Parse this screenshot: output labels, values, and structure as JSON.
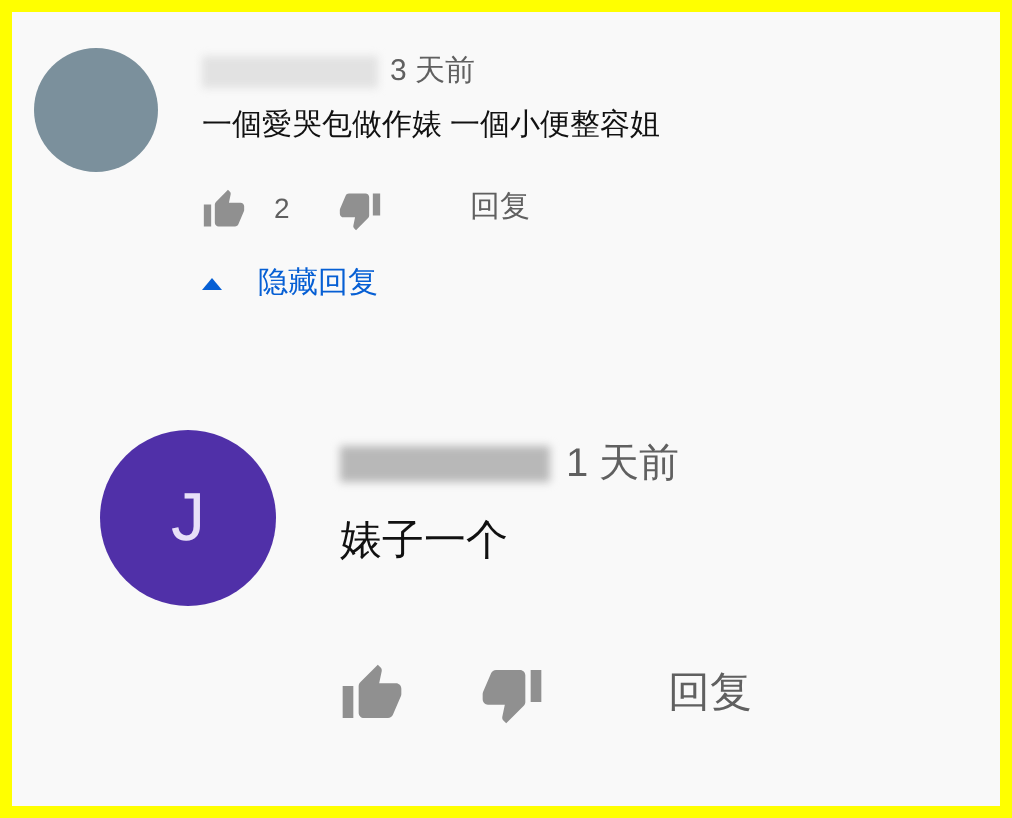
{
  "comments": [
    {
      "color": "#7b909c",
      "time": "3 天前",
      "text": "一個愛哭包做作婊 一個小便整容姐",
      "likes": "2",
      "reply_label": "回复",
      "replies_toggle": {
        "label": "隐藏回复",
        "expanded": true
      },
      "replies": [
        {
          "avatar_letter": "J",
          "color": "#5030a8",
          "time": "1 天前",
          "text": "婊子一个",
          "reply_label": "回复"
        }
      ]
    }
  ]
}
